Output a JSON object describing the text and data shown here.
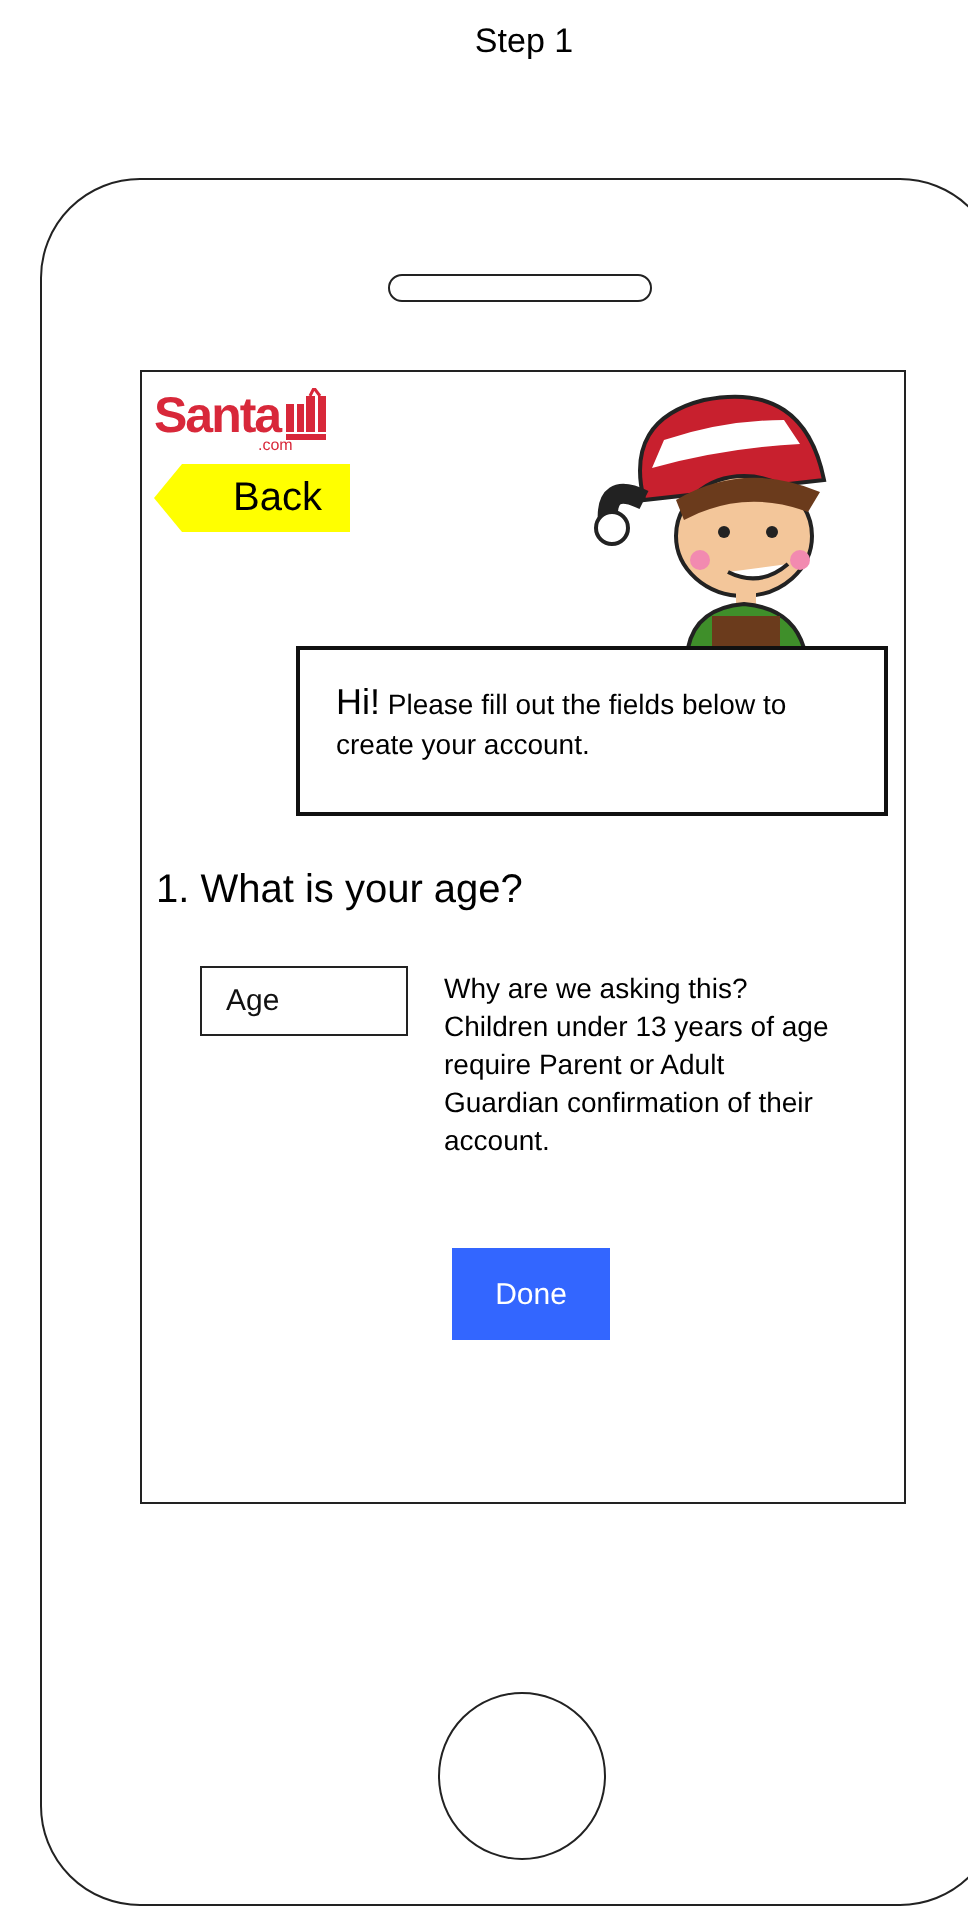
{
  "page_title": "Step 1",
  "logo": {
    "name": "Santa",
    "domain": ".com"
  },
  "back_button": {
    "label": "Back"
  },
  "speech": {
    "greeting": "Hi!",
    "message": "Please fill out the fields below to create your account."
  },
  "question": "1. What is your age?",
  "age_field": {
    "placeholder": "Age"
  },
  "help_text": "Why are we asking this? Children under 13 years of age require Parent or Adult Guardian confirmation of their account.",
  "buttons": [
    {
      "label": "Done"
    }
  ]
}
